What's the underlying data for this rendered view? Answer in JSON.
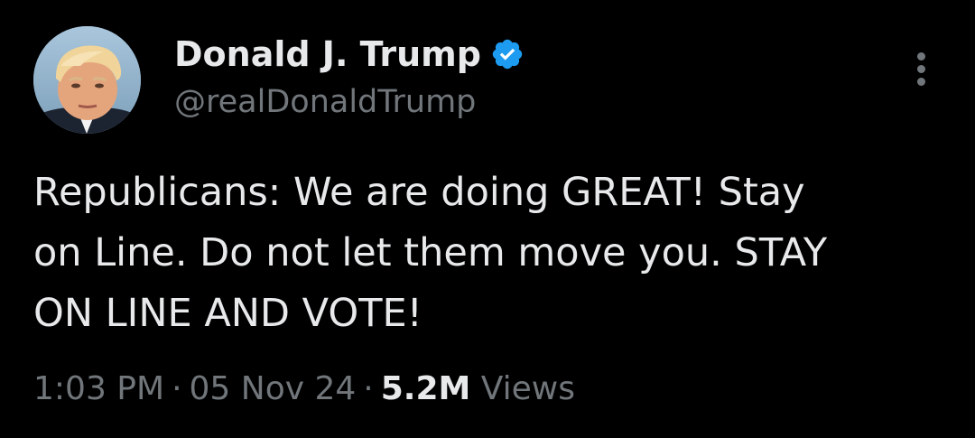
{
  "tweet": {
    "author": {
      "display_name": "Donald J. Trump",
      "handle": "@realDonaldTrump",
      "verified_icon": "verified-badge-icon",
      "avatar_icon": "profile-avatar"
    },
    "text_lines": [
      "Republicans: We are doing GREAT! Stay",
      "on Line. Do not let them move you. STAY",
      "ON LINE AND VOTE!"
    ],
    "time": "1:03 PM",
    "separator": "·",
    "date": "05 Nov 24",
    "views_count": "5.2M",
    "views_label": "Views",
    "more_icon": "more-vertical-icon"
  },
  "colors": {
    "background": "#000000",
    "text_primary": "#e7e9ea",
    "text_secondary": "#71767b",
    "verified_blue": "#1d9bf0"
  }
}
